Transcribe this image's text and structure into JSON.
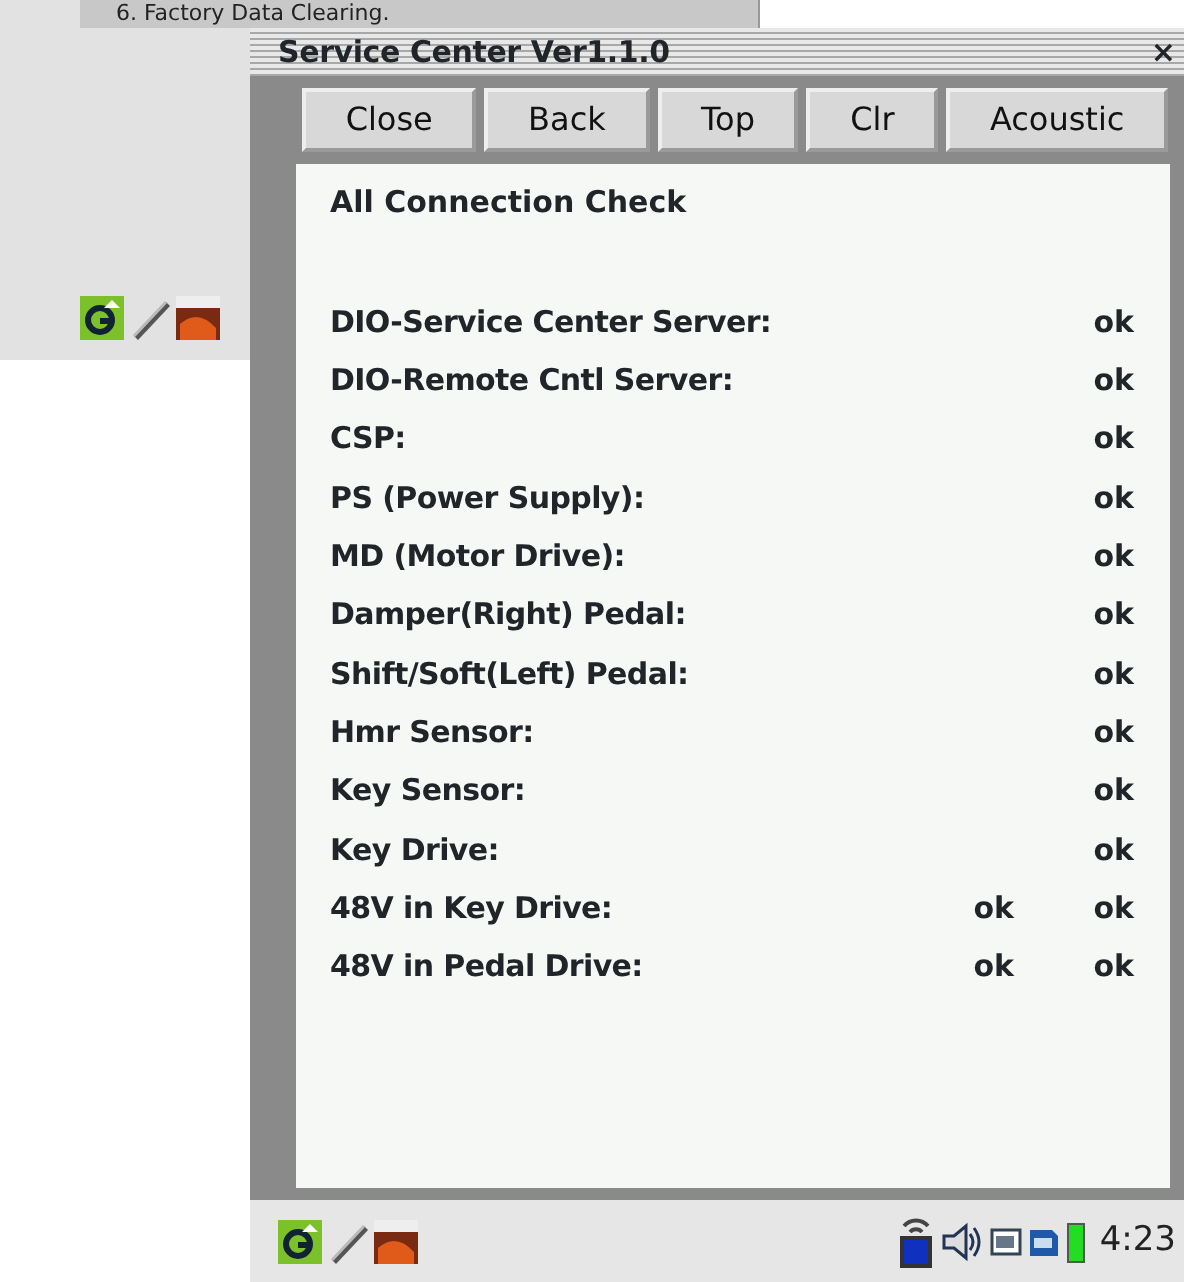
{
  "background_window": {
    "menu_item": "6. Factory Data Clearing."
  },
  "window": {
    "title": "Service Center Ver1.1.0",
    "close": "×"
  },
  "toolbar": [
    "Close",
    "Back",
    "Top",
    "Clr",
    "Acoustic"
  ],
  "heading": "All Connection Check",
  "checks": [
    {
      "label": "DIO-Service Center Server:",
      "results": [
        "ok"
      ]
    },
    {
      "label": "DIO-Remote Cntl Server:",
      "results": [
        "ok"
      ]
    },
    {
      "label": "CSP:",
      "results": [
        "ok"
      ]
    },
    {
      "label": "PS (Power Supply):",
      "results": [
        "ok"
      ]
    },
    {
      "label": "MD (Motor Drive):",
      "results": [
        "ok"
      ]
    },
    {
      "label": "Damper(Right) Pedal:",
      "results": [
        "ok"
      ]
    },
    {
      "label": "Shift/Soft(Left) Pedal:",
      "results": [
        "ok"
      ]
    },
    {
      "label": "Hmr Sensor:",
      "results": [
        "ok"
      ]
    },
    {
      "label": "Key Sensor:",
      "results": [
        "ok"
      ]
    },
    {
      "label": "Key Drive:",
      "results": [
        "ok"
      ]
    },
    {
      "label": "48V in Key Drive:",
      "results": [
        "ok",
        "ok"
      ]
    },
    {
      "label": "48V in Pedal Drive:",
      "results": [
        "ok",
        "ok"
      ]
    }
  ],
  "taskbar": {
    "clock": "4:23"
  }
}
